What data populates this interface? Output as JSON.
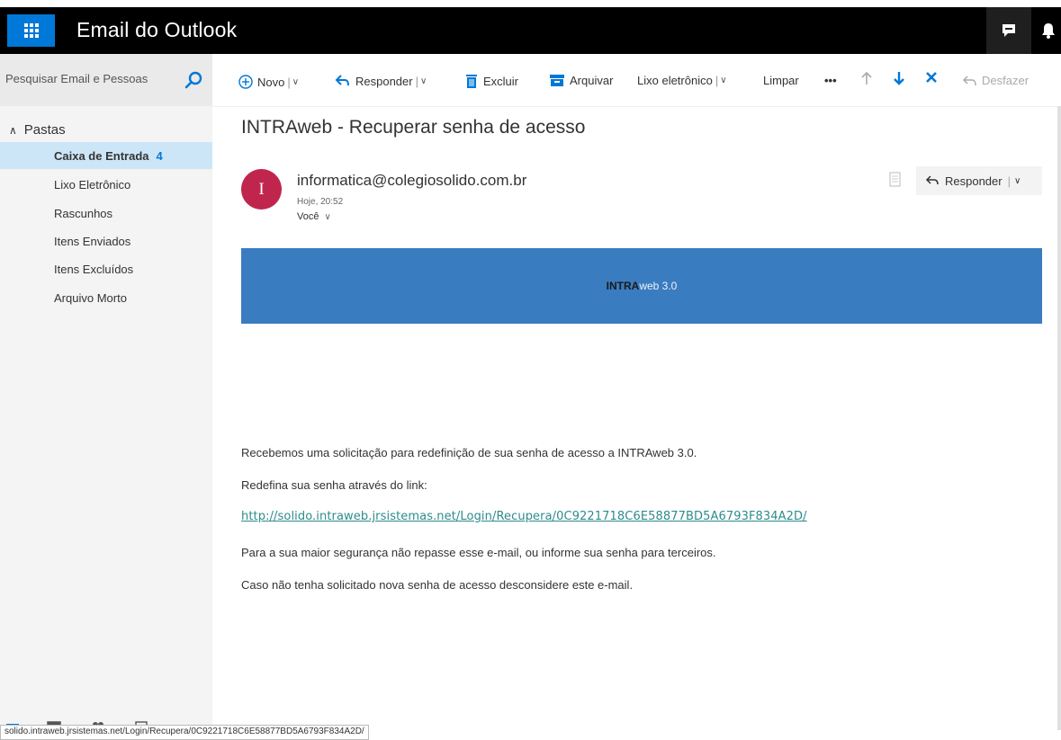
{
  "header": {
    "title": "Email do Outlook"
  },
  "search": {
    "placeholder": "Pesquisar Email e Pessoas"
  },
  "toolbar": {
    "new": "Novo",
    "reply": "Responder",
    "delete": "Excluir",
    "archive": "Arquivar",
    "junk": "Lixo eletrônico",
    "sweep": "Limpar",
    "more": "•••",
    "undo": "Desfazer"
  },
  "sidebar": {
    "folders_heading": "Pastas",
    "items": [
      {
        "label": "Caixa de Entrada",
        "count": "4"
      },
      {
        "label": "Lixo Eletrônico"
      },
      {
        "label": "Rascunhos"
      },
      {
        "label": "Itens Enviados"
      },
      {
        "label": "Itens Excluídos"
      },
      {
        "label": "Arquivo Morto"
      }
    ]
  },
  "message": {
    "subject": "INTRAweb - Recuperar senha de acesso",
    "avatar_initial": "I",
    "sender": "informatica@colegiosolido.com.br",
    "time": "Hoje, 20:52",
    "to": "Você",
    "reply_label": "Responder",
    "banner_bold": "INTRA",
    "banner_rest": "web 3.0",
    "body": [
      "Recebemos uma solicitação para redefinição de sua senha de acesso a INTRAweb 3.0.",
      "Redefina sua senha através do link:",
      "Para a sua maior segurança não repasse esse e-mail, ou informe sua senha para terceiros.",
      "Caso não tenha solicitado nova senha de acesso desconsidere este e-mail."
    ],
    "link": "http://solido.intraweb.jrsistemas.net/Login/Recupera/0C9221718C6E58877BD5A6793F834A2D/"
  },
  "statusbar": {
    "url": "solido.intraweb.jrsistemas.net/Login/Recupera/0C9221718C6E58877BD5A6793F834A2D/"
  },
  "colors": {
    "accent": "#0078d7",
    "banner": "#3a7cc0",
    "avatar": "#c0264d",
    "link": "#2e8b8b"
  }
}
